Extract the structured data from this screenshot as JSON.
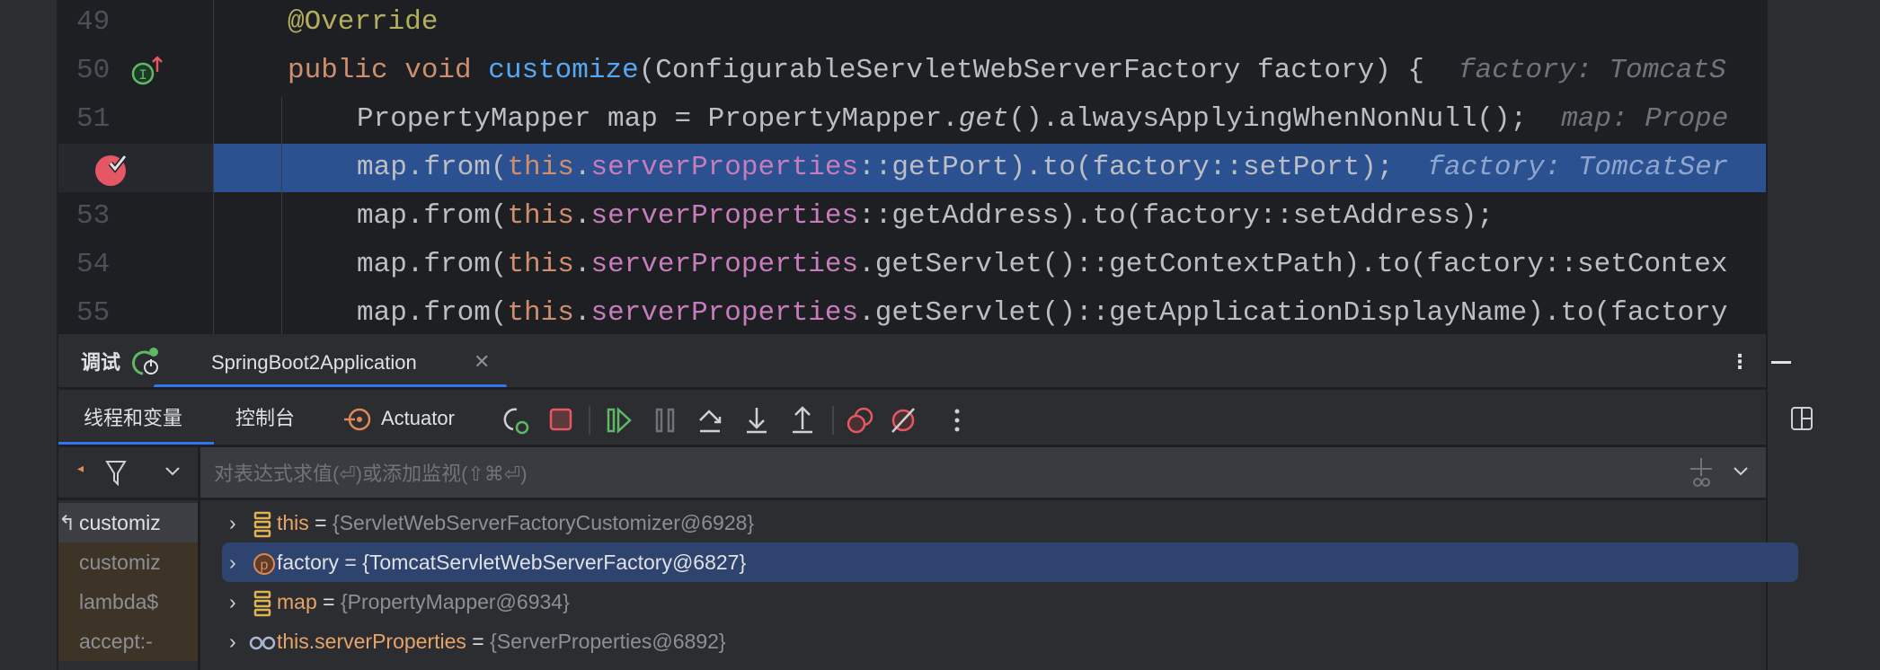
{
  "editor": {
    "lines": [
      {
        "num": "49",
        "tokens": [
          {
            "t": "@Override",
            "c": "#b3ae60"
          }
        ]
      },
      {
        "num": "50",
        "tokens": [
          {
            "t": "public void ",
            "c": "#cf8e6d"
          },
          {
            "t": "customize",
            "c": "#56a8f5"
          },
          {
            "t": "(ConfigurableServletWebServerFactory factory) {",
            "c": "#bcbec4"
          }
        ],
        "hint": "factory: TomcatS",
        "gutter_icon": "implements-override-icon"
      },
      {
        "num": "51",
        "indent": 1,
        "tokens": [
          {
            "t": "PropertyMapper map = PropertyMapper.",
            "c": "#bcbec4"
          },
          {
            "t": "get",
            "c": "#bcbec4",
            "i": true
          },
          {
            "t": "().alwaysApplyingWhenNonNull();",
            "c": "#bcbec4"
          }
        ],
        "hint": "map: Prope"
      },
      {
        "num": "",
        "indent": 1,
        "highlight": true,
        "gutter_icon": "breakpoint-icon",
        "tokens": [
          {
            "t": "map.from(",
            "c": "#bcbec4"
          },
          {
            "t": "this",
            "c": "#cf8e6d"
          },
          {
            "t": ".",
            "c": "#bcbec4"
          },
          {
            "t": "serverProperties",
            "c": "#c77dbb"
          },
          {
            "t": "::getPort).to(factory::setPort);",
            "c": "#bcbec4"
          }
        ],
        "hint": "factory: TomcatSer"
      },
      {
        "num": "53",
        "indent": 1,
        "tokens": [
          {
            "t": "map.from(",
            "c": "#bcbec4"
          },
          {
            "t": "this",
            "c": "#cf8e6d"
          },
          {
            "t": ".",
            "c": "#bcbec4"
          },
          {
            "t": "serverProperties",
            "c": "#c77dbb"
          },
          {
            "t": "::getAddress).to(factory::setAddress);",
            "c": "#bcbec4"
          }
        ]
      },
      {
        "num": "54",
        "indent": 1,
        "tokens": [
          {
            "t": "map.from(",
            "c": "#bcbec4"
          },
          {
            "t": "this",
            "c": "#cf8e6d"
          },
          {
            "t": ".",
            "c": "#bcbec4"
          },
          {
            "t": "serverProperties",
            "c": "#c77dbb"
          },
          {
            "t": ".getServlet()::getContextPath).to(factory::setContex",
            "c": "#bcbec4"
          }
        ]
      },
      {
        "num": "55",
        "indent": 1,
        "tokens": [
          {
            "t": "map.from(",
            "c": "#bcbec4"
          },
          {
            "t": "this",
            "c": "#cf8e6d"
          },
          {
            "t": ".",
            "c": "#bcbec4"
          },
          {
            "t": "serverProperties",
            "c": "#c77dbb"
          },
          {
            "t": ".getServlet()::getApplicationDisplayName).to(factory",
            "c": "#bcbec4"
          }
        ]
      }
    ]
  },
  "debug": {
    "title": "调试",
    "session_tab": "SpringBoot2Application",
    "tabs": {
      "threads": "线程和变量",
      "console": "控制台",
      "actuator": "Actuator"
    },
    "expression_placeholder": "对表达式求值(⏎)或添加监视(⇧⌘⏎)",
    "frames": [
      "customiz",
      "customiz",
      "lambda$",
      "accept:-"
    ],
    "variables": [
      {
        "name": "this",
        "value": "{ServletWebServerFactoryCustomizer@6928}",
        "icon": "field-icon"
      },
      {
        "name": "factory",
        "value": "{TomcatServletWebServerFactory@6827}",
        "icon": "parameter-icon",
        "selected": true
      },
      {
        "name": "map",
        "value": "{PropertyMapper@6934}",
        "icon": "field-icon"
      },
      {
        "name": "this.serverProperties",
        "value": "{ServerProperties@6892}",
        "icon": "watch-icon"
      }
    ]
  },
  "colors": {
    "accent": "#3574f0",
    "selection": "#2b5190",
    "breakpoint": "#e55765"
  }
}
